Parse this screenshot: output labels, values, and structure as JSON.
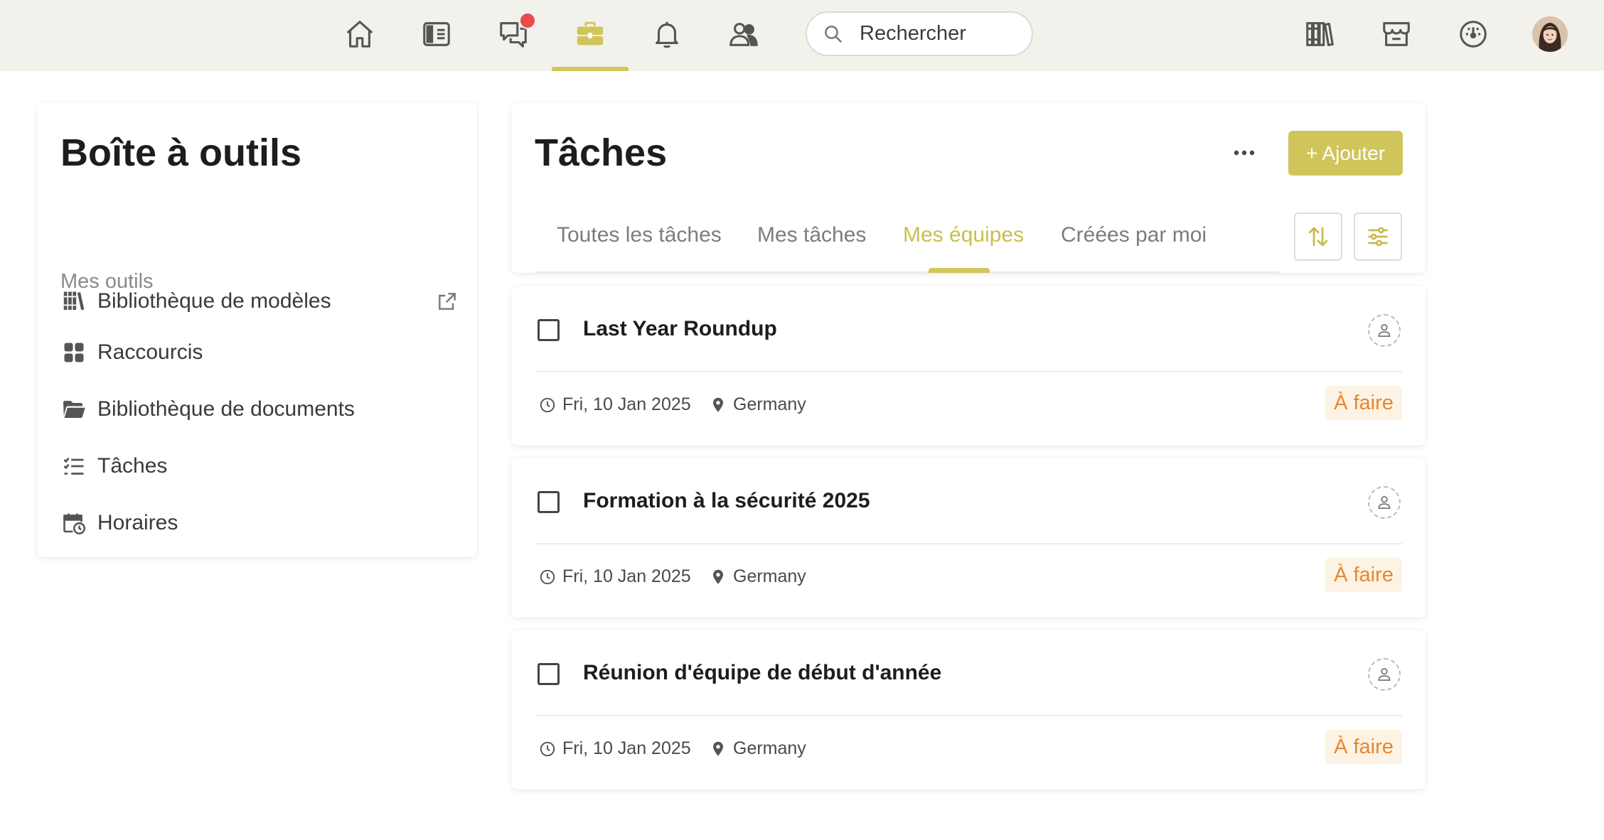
{
  "topbar": {
    "search_placeholder": "Rechercher",
    "nav_icons": [
      "home-icon",
      "sidebar-icon",
      "chat-icon",
      "toolbox-icon",
      "bell-icon",
      "people-icon"
    ],
    "right_icons": [
      "library-icon",
      "store-icon",
      "dashboard-icon"
    ],
    "active_icon": "toolbox-icon",
    "accent_color": "#d2c65a",
    "notification_color": "#ec4a4a"
  },
  "toolbox": {
    "title": "Boîte à outils",
    "template_library_label": "Bibliothèque de modèles",
    "section_label": "Mes outils",
    "items": [
      {
        "label": "Raccourcis",
        "icon": "grid-icon"
      },
      {
        "label": "Bibliothèque de documents",
        "icon": "folder-open-icon"
      },
      {
        "label": "Tâches",
        "icon": "checklist-icon"
      },
      {
        "label": "Horaires",
        "icon": "calendar-clock-icon"
      }
    ]
  },
  "tasks": {
    "title": "Tâches",
    "add_label": "+ Ajouter",
    "tabs": [
      {
        "label": "Toutes les tâches",
        "active": false
      },
      {
        "label": "Mes tâches",
        "active": false
      },
      {
        "label": "Mes équipes",
        "active": true
      },
      {
        "label": "Créées par moi",
        "active": false
      }
    ],
    "items": [
      {
        "title": "Last Year Roundup",
        "date": "Fri, 10 Jan 2025",
        "location": "Germany",
        "status": "À faire"
      },
      {
        "title": "Formation à la sécurité 2025",
        "date": "Fri, 10 Jan 2025",
        "location": "Germany",
        "status": "À faire"
      },
      {
        "title": "Réunion d'équipe de début d'année",
        "date": "Fri, 10 Jan 2025",
        "location": "Germany",
        "status": "À faire"
      }
    ]
  }
}
